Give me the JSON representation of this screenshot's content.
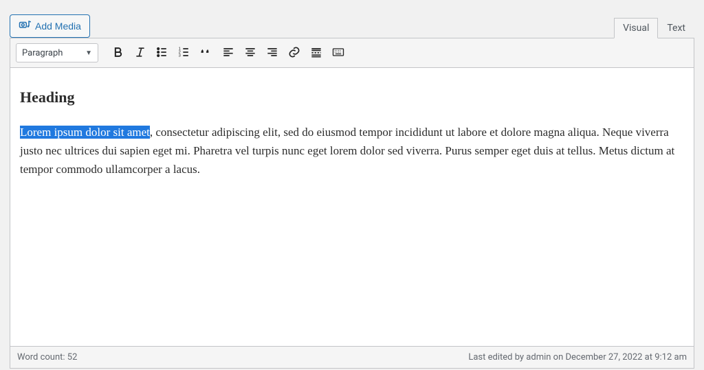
{
  "buttons": {
    "add_media": "Add Media"
  },
  "tabs": {
    "visual": "Visual",
    "text": "Text",
    "active": "visual"
  },
  "toolbar": {
    "format_selector": "Paragraph",
    "icons": {
      "bold": "bold",
      "italic": "italic",
      "ul": "bullet-list",
      "ol": "numbered-list",
      "quote": "blockquote",
      "alignleft": "align-left",
      "aligncenter": "align-center",
      "alignright": "align-right",
      "link": "insert-link",
      "more": "read-more",
      "kitchensink": "toolbar-toggle"
    }
  },
  "content": {
    "heading": "Heading",
    "selected_text": "Lorem ipsum dolor sit amet",
    "body_rest": ", consectetur adipiscing elit, sed do eiusmod tempor incididunt ut labore et dolore magna aliqua. Neque viverra justo nec ultrices dui sapien eget mi. Pharetra vel turpis nunc eget lorem dolor sed viverra. Purus semper eget duis at tellus. Metus dictum at tempor commodo ullamcorper a lacus."
  },
  "status": {
    "word_count_label": "Word count: ",
    "word_count_value": "52",
    "last_edited": "Last edited by admin on December 27, 2022 at 9:12 am"
  },
  "colors": {
    "accent": "#2271b1",
    "selection": "#2079df",
    "chrome_border": "#c3c4c7",
    "chrome_bg": "#f5f5f5"
  }
}
